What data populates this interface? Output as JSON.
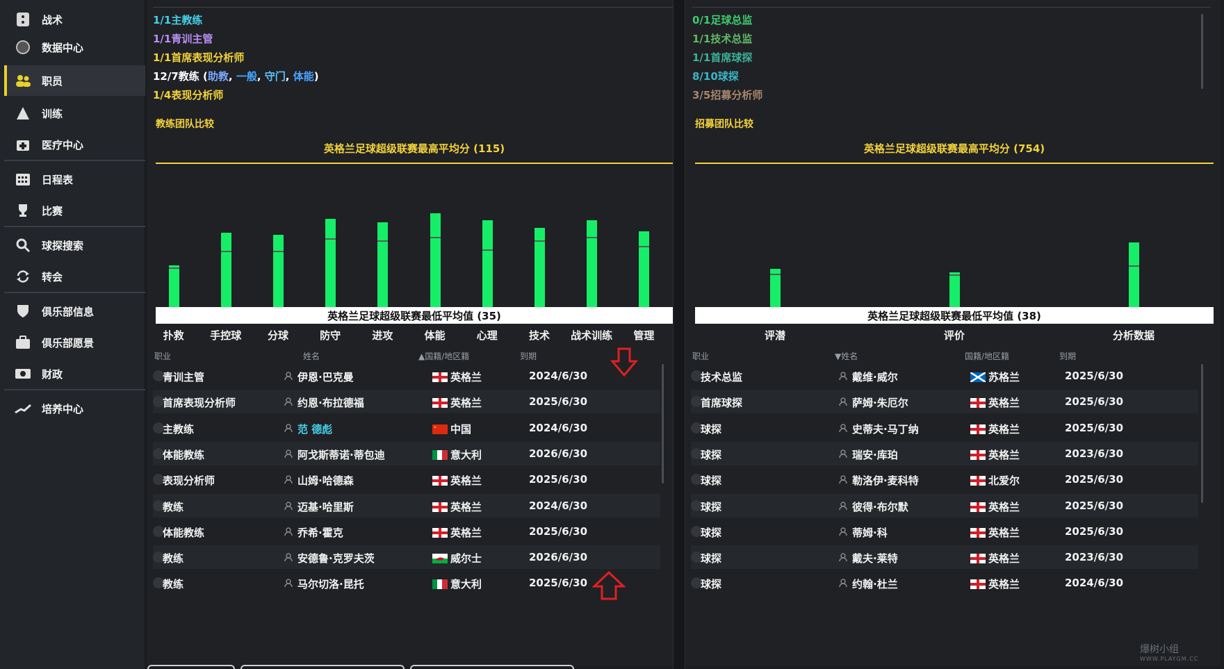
{
  "colors": {
    "accent": "#e8d22a",
    "bar": "#16ee68",
    "chart_title": "#f3d23a",
    "link": "#4aa3ff"
  },
  "sidebar": {
    "items": [
      {
        "label": "战术",
        "icon": "tactics-icon"
      },
      {
        "label": "数据中心",
        "icon": "data-hub-icon"
      },
      {
        "label": "职员",
        "icon": "staff-icon",
        "active": true
      },
      {
        "label": "训练",
        "icon": "training-icon"
      },
      {
        "label": "医疗中心",
        "icon": "medical-icon"
      },
      {
        "label": "日程表",
        "icon": "calendar-icon"
      },
      {
        "label": "比赛",
        "icon": "trophy-icon"
      },
      {
        "label": "球探搜索",
        "icon": "search-icon"
      },
      {
        "label": "转会",
        "icon": "transfer-icon"
      },
      {
        "label": "俱乐部信息",
        "icon": "shield-icon"
      },
      {
        "label": "俱乐部愿景",
        "icon": "briefcase-icon"
      },
      {
        "label": "财政",
        "icon": "finance-icon"
      },
      {
        "label": "培养中心",
        "icon": "development-icon"
      }
    ]
  },
  "left": {
    "summary": {
      "head_coach": "1/1主教练",
      "youth_manager": "1/1青训主管",
      "chief_analyst": "1/1首席表现分析师",
      "coaches_prefix": "12/7教练 (",
      "coach_types": [
        "助教",
        "一般",
        "守门",
        "体能"
      ],
      "coaches_suffix": ")",
      "analysts": "1/4表现分析师"
    },
    "compare_title": "教练团队比较",
    "chart_max_label": "英格兰足球超级联赛最高平均分 (115)",
    "chart_min_label": "英格兰足球超级联赛最低平均值 (35)",
    "table_headers": {
      "role": "职业",
      "name": "姓名",
      "nation": "国籍/地区籍",
      "expiry": "到期"
    },
    "rows": [
      {
        "role": "青训主管",
        "name": "伊恩·巴克曼",
        "nation": "英格兰",
        "flag": "england",
        "expiry": "2024/6/30"
      },
      {
        "role": "首席表现分析师",
        "name": "约恩·布拉德福",
        "nation": "英格兰",
        "flag": "england",
        "expiry": "2025/6/30"
      },
      {
        "role": "主教练",
        "name": "范 德彪",
        "nation": "中国",
        "flag": "china",
        "expiry": "2024/6/30",
        "highlight": true
      },
      {
        "role": "体能教练",
        "name": "阿戈斯蒂诺·蒂包迪",
        "nation": "意大利",
        "flag": "italy",
        "expiry": "2026/6/30"
      },
      {
        "role": "表现分析师",
        "name": "山姆·哈德森",
        "nation": "英格兰",
        "flag": "england",
        "expiry": "2025/6/30"
      },
      {
        "role": "教练",
        "name": "迈基·哈里斯",
        "nation": "英格兰",
        "flag": "england",
        "expiry": "2024/6/30"
      },
      {
        "role": "体能教练",
        "name": "乔希·霍克",
        "nation": "英格兰",
        "flag": "england",
        "expiry": "2025/6/30"
      },
      {
        "role": "教练",
        "name": "安德鲁·克罗夫茨",
        "nation": "威尔士",
        "flag": "wales",
        "expiry": "2026/6/30"
      },
      {
        "role": "教练",
        "name": "马尔切洛·昆托",
        "nation": "意大利",
        "flag": "italy",
        "expiry": "2025/6/30"
      }
    ]
  },
  "right": {
    "summary": {
      "director_football": "0/1足球总监",
      "technical_director": "1/1技术总监",
      "chief_scout": "1/1首席球探",
      "scouts": "8/10球探",
      "recruitment_analysts": "3/5招募分析师"
    },
    "compare_title": "招募团队比较",
    "chart_max_label": "英格兰足球超级联赛最高平均分 (754)",
    "chart_min_label": "英格兰足球超级联赛最低平均值 (38)",
    "table_headers": {
      "role": "职业",
      "name": "姓名",
      "nation": "国籍/地区籍",
      "expiry": "到期"
    },
    "rows": [
      {
        "role": "技术总监",
        "name": "戴维·威尔",
        "nation": "苏格兰",
        "flag": "scotland",
        "expiry": "2025/6/30"
      },
      {
        "role": "首席球探",
        "name": "萨姆·朱厄尔",
        "nation": "英格兰",
        "flag": "england",
        "expiry": "2025/6/30"
      },
      {
        "role": "球探",
        "name": "史蒂夫·马丁纳",
        "nation": "英格兰",
        "flag": "england",
        "expiry": "2025/6/30"
      },
      {
        "role": "球探",
        "name": "瑞安·库珀",
        "nation": "英格兰",
        "flag": "england",
        "expiry": "2023/6/30"
      },
      {
        "role": "球探",
        "name": "勒洛伊·麦科特",
        "nation": "北爱尔",
        "flag": "england",
        "expiry": "2025/6/30"
      },
      {
        "role": "球探",
        "name": "彼得·布尔默",
        "nation": "英格兰",
        "flag": "england",
        "expiry": "2025/6/30"
      },
      {
        "role": "球探",
        "name": "蒂姆·科",
        "nation": "英格兰",
        "flag": "england",
        "expiry": "2025/6/30"
      },
      {
        "role": "球探",
        "name": "戴夫·莱特",
        "nation": "英格兰",
        "flag": "england",
        "expiry": "2023/6/30"
      },
      {
        "role": "球探",
        "name": "约翰·杜兰",
        "nation": "英格兰",
        "flag": "england",
        "expiry": "2024/6/30"
      }
    ]
  },
  "chart_data": [
    {
      "type": "bar",
      "title": "英格兰足球超级联赛最高平均分 (115)",
      "categories": [
        "扑救",
        "手控球",
        "分球",
        "防守",
        "进攻",
        "体能",
        "心理",
        "技术",
        "战术训练",
        "管理"
      ],
      "ylim": [
        35,
        115
      ],
      "series": [
        {
          "values": [
            58,
            76,
            75,
            84,
            82,
            87,
            83,
            79,
            83,
            77
          ]
        }
      ],
      "league_average": [
        57,
        66,
        66,
        73,
        72,
        74,
        67,
        72,
        74,
        69
      ]
    },
    {
      "type": "bar",
      "title": "英格兰足球超级联赛最高平均分 (754)",
      "categories": [
        "评潜",
        "评价",
        "分析数据"
      ],
      "ylim": [
        38,
        754
      ],
      "series": [
        {
          "values": [
            228,
            211,
            358
          ]
        }
      ],
      "league_average": [
        204,
        201,
        243
      ]
    }
  ],
  "watermark": {
    "text": "爆树小组",
    "sub": "WWW.PLAYGM.CC"
  }
}
